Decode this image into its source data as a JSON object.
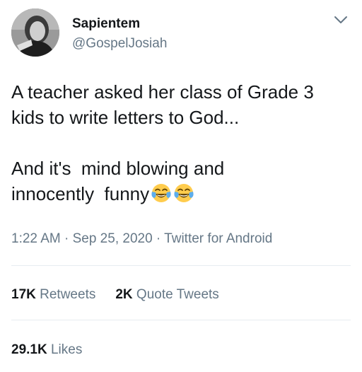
{
  "user": {
    "display_name": "Sapientem",
    "handle": "@GospelJosiah"
  },
  "tweet": {
    "line1": "A teacher asked her class of Grade 3",
    "line2": "kids to write letters to God...",
    "line3": "And it's  mind blowing and",
    "line4": "innocently  funny",
    "emoji": "face-with-tears-of-joy",
    "timestamp": "1:22 AM · Sep 25, 2020 · Twitter for Android"
  },
  "stats": {
    "retweets_count": "17K",
    "retweets_label": "Retweets",
    "quotes_count": "2K",
    "quotes_label": "Quote Tweets",
    "likes_count": "29.1K",
    "likes_label": "Likes"
  },
  "colors": {
    "text": "#14171a",
    "secondary": "#657786",
    "divider": "#e6ecf0"
  }
}
